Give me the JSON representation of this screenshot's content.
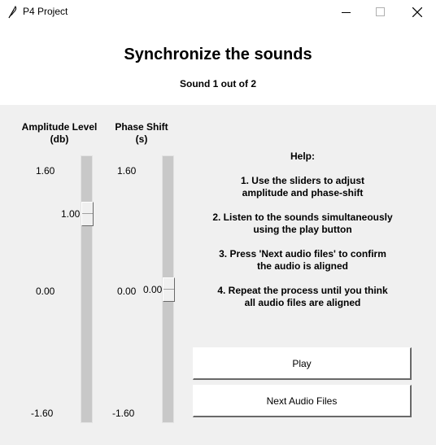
{
  "window": {
    "title": "P4 Project",
    "icons": {
      "app": "feather-icon",
      "minimize": "minimize-icon",
      "maximize": "maximize-icon",
      "close": "close-icon"
    }
  },
  "header": {
    "title": "Synchronize the sounds",
    "sound_counter": "Sound 1 out of 2"
  },
  "amplitude_slider": {
    "label_line1": "Amplitude Level",
    "label_line2": "(db)",
    "max": "1.60",
    "mid": "0.00",
    "min": "-1.60",
    "current_value": "1.00",
    "value_fraction": 0.8125
  },
  "phase_slider": {
    "label_line1": "Phase Shift",
    "label_line2": "(s)",
    "max": "1.60",
    "mid": "0.00",
    "min": "-1.60",
    "current_value": "0.00",
    "value_fraction": 0.5
  },
  "help": {
    "title": "Help:",
    "step1_line1": "1. Use the sliders to adjust",
    "step1_line2": "amplitude and phase-shift",
    "step2_line1": "2. Listen to the sounds simultaneously",
    "step2_line2": "using the play button",
    "step3_line1": "3. Press 'Next audio files' to confirm",
    "step3_line2": "the audio is aligned",
    "step4_line1": "4. Repeat the process until you think",
    "step4_line2": "all audio files are aligned"
  },
  "buttons": {
    "play": "Play",
    "next": "Next Audio Files"
  }
}
